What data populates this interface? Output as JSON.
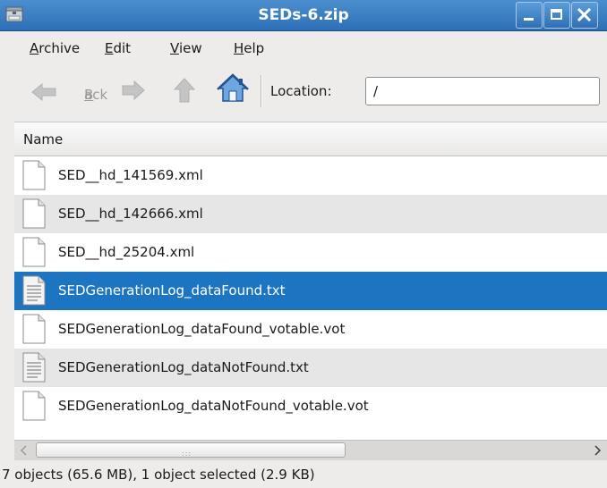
{
  "window": {
    "title": "SEDs-6.zip",
    "title_bar_color": "#3a7fc4",
    "controls": [
      "minimize-icon",
      "maximize-icon",
      "close-icon"
    ]
  },
  "menubar": {
    "items": [
      {
        "label": "Archive",
        "mnemonic": "A",
        "rest": "rchive"
      },
      {
        "label": "Edit",
        "mnemonic": "E",
        "rest": "dit"
      },
      {
        "label": "View",
        "mnemonic": "V",
        "rest": "iew"
      },
      {
        "label": "Help",
        "mnemonic": "H",
        "rest": "elp"
      }
    ]
  },
  "toolbar": {
    "back_label": "Back",
    "back_mnemonic": "B",
    "back_rest": "ack",
    "back_enabled": false,
    "forward_enabled": false,
    "up_enabled": false,
    "location_label": "Location:",
    "location_value": "/"
  },
  "file_list": {
    "column_header": "Name",
    "selection_color": "#1d75c2",
    "files": [
      {
        "name": "SED__hd_141569.xml",
        "icon": "blank-document-icon",
        "selected": false
      },
      {
        "name": "SED__hd_142666.xml",
        "icon": "blank-document-icon",
        "selected": false
      },
      {
        "name": "SED__hd_25204.xml",
        "icon": "blank-document-icon",
        "selected": false
      },
      {
        "name": "SEDGenerationLog_dataFound.txt",
        "icon": "text-document-icon",
        "selected": true
      },
      {
        "name": "SEDGenerationLog_dataFound_votable.vot",
        "icon": "blank-document-icon",
        "selected": false
      },
      {
        "name": "SEDGenerationLog_dataNotFound.txt",
        "icon": "text-document-icon",
        "selected": false
      },
      {
        "name": "SEDGenerationLog_dataNotFound_votable.vot",
        "icon": "blank-document-icon",
        "selected": false
      }
    ]
  },
  "status": {
    "text": "7 objects (65.6 MB), 1 object selected (2.9 KB)"
  }
}
